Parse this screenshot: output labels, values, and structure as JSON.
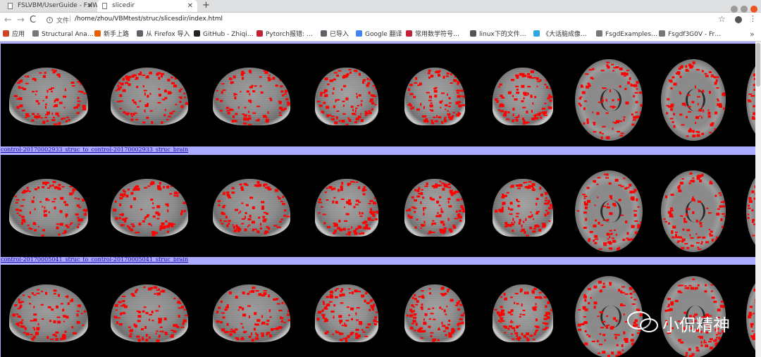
{
  "tabs": [
    {
      "title": "FSLVBM/UserGuide - FslW",
      "active": false
    },
    {
      "title": "slicedir",
      "active": true
    }
  ],
  "toolbar": {
    "back": "←",
    "forward": "→",
    "reload": "C",
    "info_glyph": "i",
    "scheme": "文件",
    "separator": "|",
    "url": "/home/zhou/VBMtest/struc/slicesdir/index.html",
    "bookmark_star": "☆",
    "menu_glyph": "⋮"
  },
  "bookmarks": [
    {
      "label": "应用",
      "icon": "apps-grid-icon",
      "color": "#d04424"
    },
    {
      "label": "Structural Ana…",
      "icon": "page-icon",
      "color": "#777777"
    },
    {
      "label": "新手上路",
      "icon": "firefox-icon",
      "color": "#e66000"
    },
    {
      "label": "从 Firefox 导入",
      "icon": "folder-icon",
      "color": "#5f6368"
    },
    {
      "label": "GitHub - Zhiqi…",
      "icon": "github-icon",
      "color": "#222222"
    },
    {
      "label": "Pytorch报错: …",
      "icon": "csdn-icon",
      "color": "#c32136"
    },
    {
      "label": "已导入",
      "icon": "folder-icon",
      "color": "#5f6368"
    },
    {
      "label": "Google 翻译",
      "icon": "google-translate-icon",
      "color": "#4285f4"
    },
    {
      "label": "常用数学符号…",
      "icon": "csdn-icon",
      "color": "#c32136"
    },
    {
      "label": "linux下的文件…",
      "icon": "page-icon",
      "color": "#555555"
    },
    {
      "label": "《大话脑成像…",
      "icon": "cloud-icon",
      "color": "#2aa6e0"
    },
    {
      "label": "FsgdExamples…",
      "icon": "page-icon",
      "color": "#777777"
    },
    {
      "label": "Fsgdf3G0V - Fr…",
      "icon": "page-icon",
      "color": "#777777"
    }
  ],
  "bookmarks_more": "»",
  "rows": [
    {
      "caption": ""
    },
    {
      "caption": "control-20170002933_struc_to_control-20170002933_struc_brain"
    },
    {
      "caption": "control-20170005041_struc_to_control-20170005041_struc_brain"
    }
  ],
  "slice_types": [
    "sagittal",
    "sagittal",
    "sagittal",
    "coronal",
    "coronal",
    "coronal",
    "axial",
    "axial",
    "axial-partial"
  ],
  "colors": {
    "overlay_red": "#ff0000",
    "page_bg": "#aaaaff",
    "link": "#1a0dab"
  },
  "watermark": {
    "text": "小侃精神",
    "icon": "wechat-icon"
  }
}
